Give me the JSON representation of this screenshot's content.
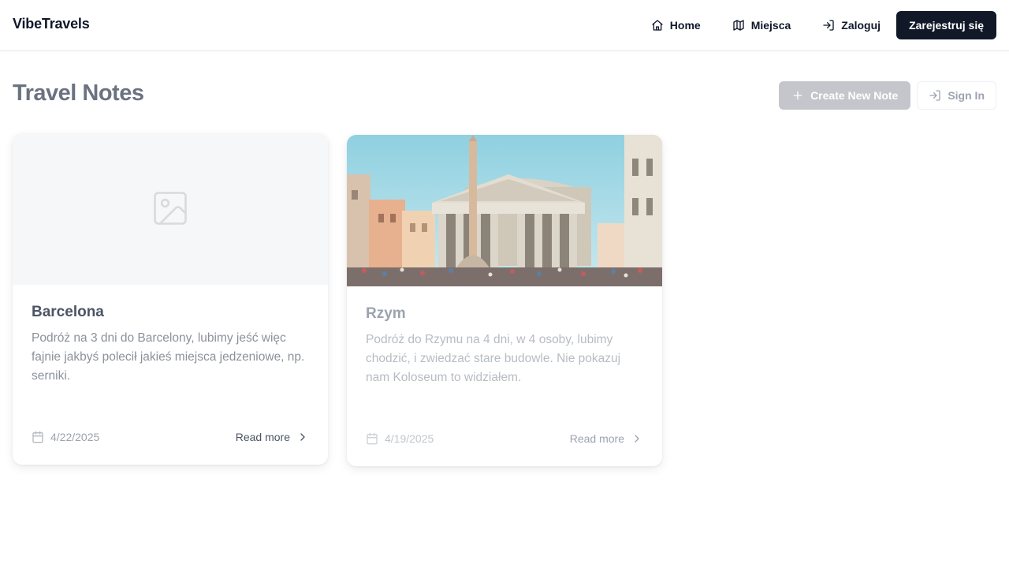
{
  "header": {
    "brand": "VibeTravels",
    "nav": [
      {
        "label": "Home",
        "icon": "home-icon"
      },
      {
        "label": "Miejsca",
        "icon": "map-icon"
      },
      {
        "label": "Zaloguj",
        "icon": "login-icon"
      }
    ],
    "cta": "Zarejestruj się"
  },
  "page": {
    "title": "Travel Notes",
    "create_button": "Create New Note",
    "signin_button": "Sign In"
  },
  "notes": [
    {
      "title": "Barcelona",
      "description": "Podróż na 3 dni do Barcelony, lubimy jeść więc fajnie jakbyś polecił jakieś miejsca jedzeniowe, np. serniki.",
      "date": "4/22/2025",
      "read_more": "Read more",
      "image": "image-placeholder-icon"
    },
    {
      "title": "Rzym",
      "description": "Podróż do Rzymu na 4 dni, w 4 osoby, lubimy chodzić, i zwiedzać stare budowle. Nie pokazuj nam Koloseum to widziałem.",
      "date": "4/19/2025",
      "read_more": "Read more",
      "image": "pantheon-photo"
    }
  ],
  "colors": {
    "primary": "#111827",
    "create_button_disabled": "#c4c6cb",
    "border": "#e5e7eb"
  }
}
